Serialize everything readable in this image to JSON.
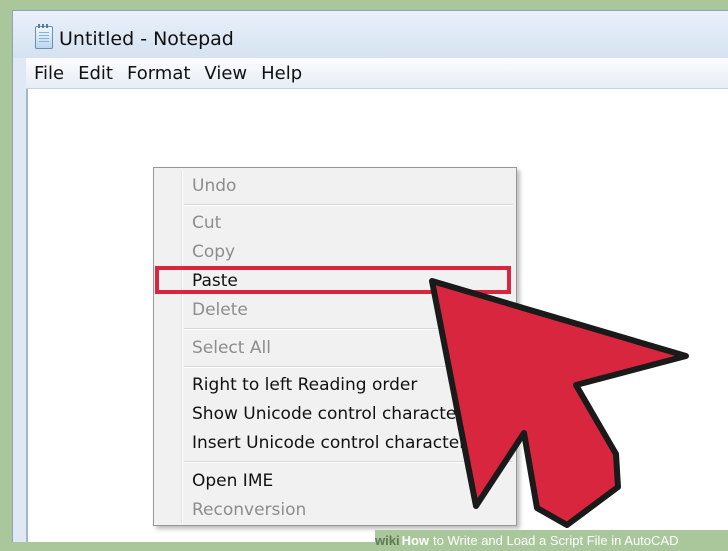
{
  "window": {
    "title": "Untitled - Notepad"
  },
  "menubar": {
    "items": [
      "File",
      "Edit",
      "Format",
      "View",
      "Help"
    ]
  },
  "context_menu": {
    "items": [
      {
        "label": "Undo",
        "enabled": false
      },
      {
        "label": "Cut",
        "enabled": false
      },
      {
        "label": "Copy",
        "enabled": false
      },
      {
        "label": "Paste",
        "enabled": true,
        "highlighted": true
      },
      {
        "label": "Delete",
        "enabled": false
      },
      {
        "label": "Select All",
        "enabled": false
      },
      {
        "label": "Right to left Reading order",
        "enabled": true
      },
      {
        "label": "Show Unicode control characters",
        "enabled": true
      },
      {
        "label": "Insert Unicode control character",
        "enabled": true
      },
      {
        "label": "Open IME",
        "enabled": true
      },
      {
        "label": "Reconversion",
        "enabled": false
      }
    ]
  },
  "footer": {
    "wiki": "wiki",
    "how": "How",
    "rest": "to Write and Load a Script File in AutoCAD"
  },
  "colors": {
    "highlight": "#d7263d",
    "arrow_fill": "#d7263d",
    "background": "#a9c79a"
  }
}
